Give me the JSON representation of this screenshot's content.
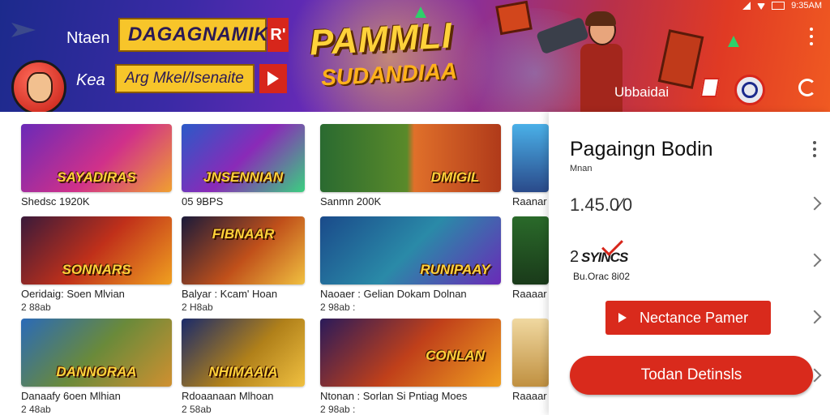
{
  "status_bar": {
    "time": "9:35AM"
  },
  "banner": {
    "left_label_1": "Ntaen",
    "yellow_button_1": "DAGAGNAMIK",
    "red_tag_1": "R'",
    "left_label_2": "Kea",
    "yellow_button_2": "Arg Mkel/Isenaite",
    "logo_title": "PAMMLI",
    "logo_subtitle": "SUDANDIAA",
    "right_label": "Ubbaidai",
    "colors": {
      "accent": "#d7261b",
      "banner_blue": "#1c2a8c",
      "banner_red": "#e03a24",
      "gold": "#f7c52a"
    }
  },
  "games": [
    {
      "thumb_title": "SAYADIRAS",
      "caption": "Shedsc 1920K",
      "meta": ""
    },
    {
      "thumb_title": "JNSENNIAN",
      "caption": "05 9BPS",
      "meta": ""
    },
    {
      "thumb_title": "DMIGIL",
      "caption": "Sanmn 200K",
      "meta": ""
    },
    {
      "thumb_title": "",
      "caption": "Raanar",
      "meta": ""
    },
    {
      "thumb_title": "SONNARS",
      "caption": "Oeridaig: Soen Mlvian",
      "meta": "2 88ab"
    },
    {
      "thumb_title": "FIBNAAR",
      "caption": "Balyar : Kcam' Hoan",
      "meta": "2 H8ab"
    },
    {
      "thumb_title": "RUNIPAAY",
      "caption": "Naoaer : Gelian Dokam Dolnan",
      "meta": "2 98ab :"
    },
    {
      "thumb_title": "",
      "caption": "Raaaar",
      "meta": ""
    },
    {
      "thumb_title": "DANNORAA",
      "caption": "Danaafy 6oen Mlhian",
      "meta": "2 48ab"
    },
    {
      "thumb_title": "NHIMAAIA",
      "caption": "Rdoaanaan Mlhoan",
      "meta": "2 58ab"
    },
    {
      "thumb_title": "CONLAN",
      "caption": "Ntonan : Sorlan Si Pntiag Moes",
      "meta": "2 98ab :"
    },
    {
      "thumb_title": "",
      "caption": "Raaaar",
      "meta": ""
    }
  ],
  "panel": {
    "title": "Pagaingn Bodin",
    "subtitle": "Mnan",
    "rating": "1.45.0⁄0",
    "logo_number": "2",
    "logo_word": "SYINCS",
    "meta": "Bu.Orac 8i02",
    "button_primary": "Nectance Pamer",
    "button_secondary": "Todan Detinsls"
  }
}
